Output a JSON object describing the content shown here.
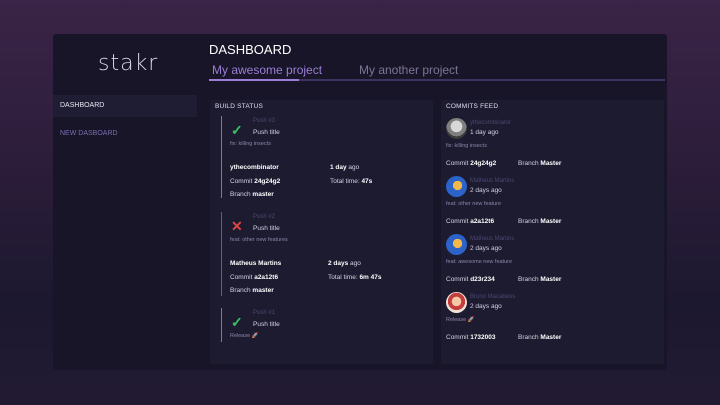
{
  "app": {
    "logo": "stakr",
    "page_title": "DASHBOARD"
  },
  "tabs": [
    {
      "label": "My awesome project",
      "active": true
    },
    {
      "label": "My another project",
      "active": false
    }
  ],
  "sidebar": {
    "items": [
      {
        "label": "DASHBOARD",
        "active": true
      },
      {
        "label": "NEW DASBOARD",
        "active": false
      }
    ]
  },
  "build_status": {
    "title": "BUILD STATUS",
    "builds": [
      {
        "status": "success",
        "icon": "check-icon",
        "push": "Push #3",
        "title": "Push title",
        "message": "fix: killing insects",
        "author": "ythecombinator",
        "commit_label": "Commit",
        "commit": "24g24g2",
        "branch_label": "Branch",
        "branch": "master",
        "time_value": "1 day",
        "time_suffix": " ago",
        "total_label": "Total time: ",
        "total": "47s"
      },
      {
        "status": "failed",
        "icon": "cross-icon",
        "push": "Push #2",
        "title": "Push title",
        "message": "feat: other new features",
        "author": "Matheus Martins",
        "commit_label": "Commit",
        "commit": "a2a12t6",
        "branch_label": "Branch",
        "branch": "master",
        "time_value": "2 days",
        "time_suffix": " ago",
        "total_label": "Total time: ",
        "total": "6m 47s"
      },
      {
        "status": "success",
        "icon": "check-icon",
        "push": "Push #1",
        "title": "Push title",
        "message": "Release 🚀"
      }
    ]
  },
  "commits_feed": {
    "title": "COMMITS FEED",
    "items": [
      {
        "author": "ythecombinator",
        "time": "1 day ago",
        "message": "fix: killing insects",
        "commit_label": "Commit ",
        "commit": "24g24g2",
        "branch_label": "Branch ",
        "branch": "Master"
      },
      {
        "author": "Matheus Martins",
        "time": "2 days ago",
        "message": "feat: other new feature",
        "commit_label": "Commit ",
        "commit": "a2a12t6",
        "branch_label": "Branch ",
        "branch": "Master"
      },
      {
        "author": "Matheus Martins",
        "time": "2 days ago",
        "message": "feat: awesome new feature",
        "commit_label": "Commit ",
        "commit": "d23r234",
        "branch_label": "Branch ",
        "branch": "Master"
      },
      {
        "author": "Bruno Macabeus",
        "time": "2 days ago",
        "message": "Release 🚀",
        "commit_label": "Commit ",
        "commit": "1732003",
        "branch_label": "Branch ",
        "branch": "Master"
      }
    ]
  },
  "colors": {
    "accent": "#9b7fd6",
    "success": "#3cc36a",
    "failure": "#e04545",
    "panel": "#1d1b30"
  }
}
